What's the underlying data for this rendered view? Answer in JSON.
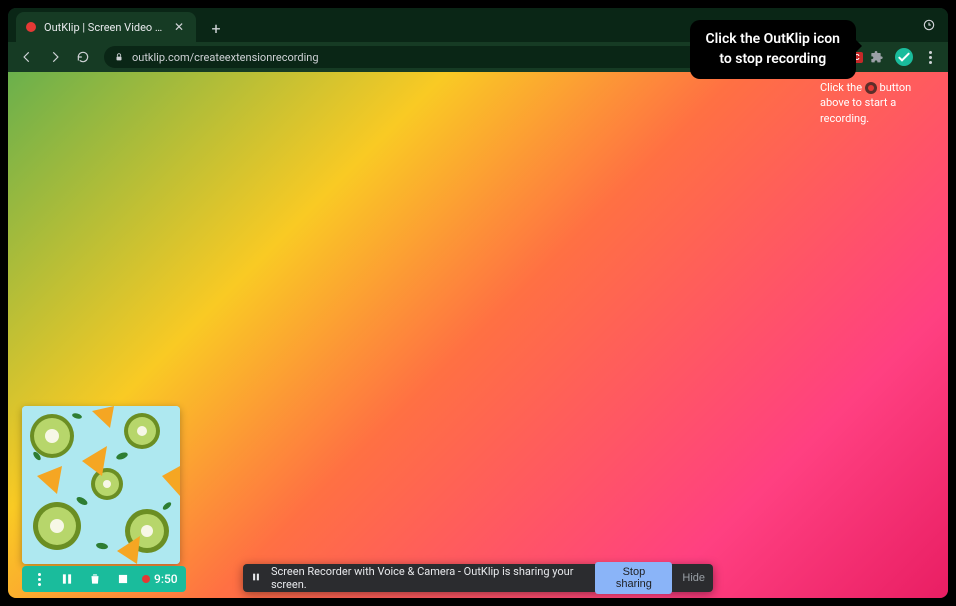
{
  "browser": {
    "tab_title": "OutKlip | Screen Video Record…",
    "url": "outklip.com/createextensionrecording",
    "extensions": {
      "rec_badge": "REC"
    }
  },
  "tooltip": {
    "line1": "Click the OutKlip icon",
    "line2": "to stop recording"
  },
  "page_hint": {
    "pre": "Click the ",
    "post": " button above to start a recording."
  },
  "recorder": {
    "timer": "9:50"
  },
  "share_bar": {
    "message": "Screen Recorder with Voice & Camera - OutKlip is sharing your screen.",
    "stop_label": "Stop sharing",
    "hide_label": "Hide"
  }
}
